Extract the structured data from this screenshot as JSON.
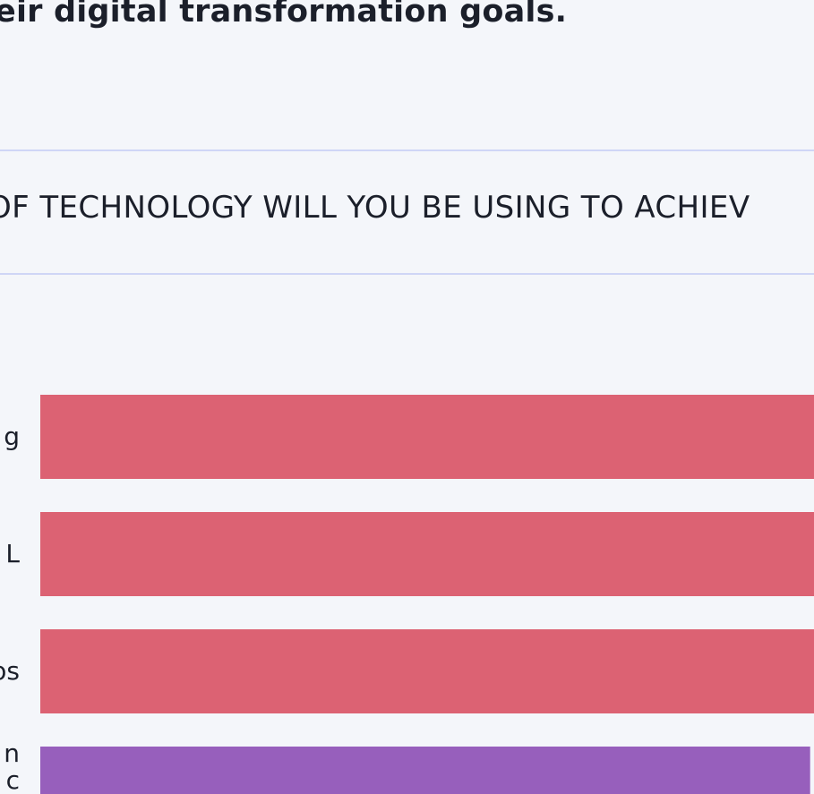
{
  "section": {
    "intro_text": "eir digital transformation goals.",
    "question": "OF TECHNOLOGY WILL YOU BE USING TO ACHIEV"
  },
  "colors": {
    "background": "#f4f6fa",
    "divider": "#cfd6f6",
    "bar_red": "#dc6273",
    "bar_purple": "#975fbc"
  },
  "chart_data": {
    "type": "bar",
    "orientation": "horizontal",
    "categories": [
      "g",
      "L",
      "os",
      "n\nc"
    ],
    "series": [
      {
        "values": [
          100,
          100,
          100,
          99.5
        ]
      }
    ],
    "bar_colors": [
      "#dc6273",
      "#dc6273",
      "#dc6273",
      "#975fbc"
    ],
    "xlim": [
      0,
      100
    ]
  }
}
